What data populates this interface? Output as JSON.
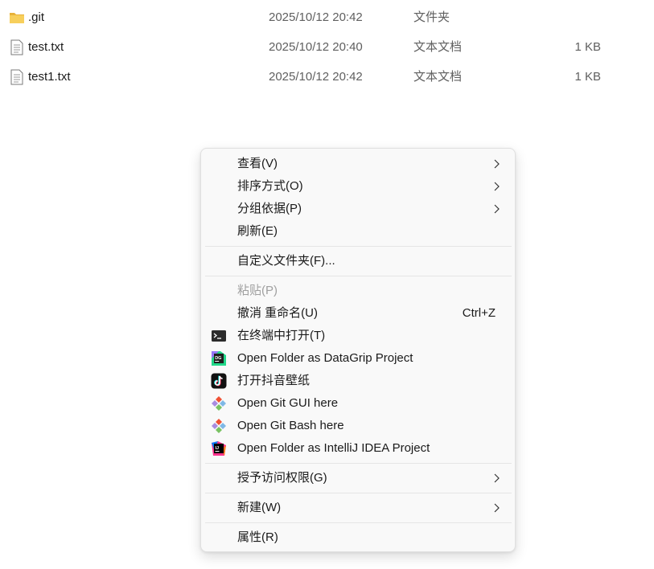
{
  "files": [
    {
      "name": ".git",
      "date": "2025/10/12 20:42",
      "type": "文件夹",
      "size": "",
      "icon": "folder-icon"
    },
    {
      "name": "test.txt",
      "date": "2025/10/12 20:40",
      "type": "文本文档",
      "size": "1 KB",
      "icon": "text-file-icon"
    },
    {
      "name": "test1.txt",
      "date": "2025/10/12 20:42",
      "type": "文本文档",
      "size": "1 KB",
      "icon": "text-file-icon"
    }
  ],
  "menu": {
    "view": "查看(V)",
    "sort": "排序方式(O)",
    "group": "分组依据(P)",
    "refresh": "刷新(E)",
    "customize": "自定义文件夹(F)...",
    "paste": "粘贴(P)",
    "undo": "撤消 重命名(U)",
    "undo_accel": "Ctrl+Z",
    "terminal": "在终端中打开(T)",
    "datagrip": "Open Folder as DataGrip Project",
    "douyin": "打开抖音壁纸",
    "git_gui": "Open Git GUI here",
    "git_bash": "Open Git Bash here",
    "intellij": "Open Folder as IntelliJ IDEA Project",
    "access": "授予访问权限(G)",
    "new": "新建(W)",
    "properties": "属性(R)"
  },
  "colors": {
    "folder": "#f2c14e",
    "git": "#f05033",
    "datagrip_bg": "#1e1e1e",
    "intellij_accent": "#fc318c"
  }
}
